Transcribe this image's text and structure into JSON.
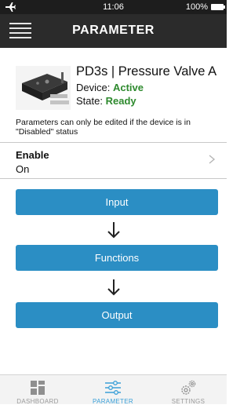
{
  "status_bar": {
    "time": "11:06",
    "battery": "100%"
  },
  "nav": {
    "title": "PARAMETER"
  },
  "device": {
    "name": "PD3s | Pressure Valve A",
    "device_label": "Device:",
    "device_status": "Active",
    "state_label": "State:",
    "state_value": "Ready"
  },
  "note": "Parameters can only be edited if the device is in \"Disabled\" status",
  "enable": {
    "label": "Enable",
    "value": "On"
  },
  "flow": {
    "input": "Input",
    "functions": "Functions",
    "output": "Output"
  },
  "tabs": [
    {
      "label": "DASHBOARD",
      "icon": "dashboard-icon"
    },
    {
      "label": "PARAMETER",
      "icon": "sliders-icon"
    },
    {
      "label": "SETTINGS",
      "icon": "gears-icon"
    }
  ],
  "colors": {
    "accent": "#2b8ec4",
    "active_status": "#2e8a2e",
    "nav_background": "#2b2b2b",
    "tab_active": "#3aa0d8"
  }
}
